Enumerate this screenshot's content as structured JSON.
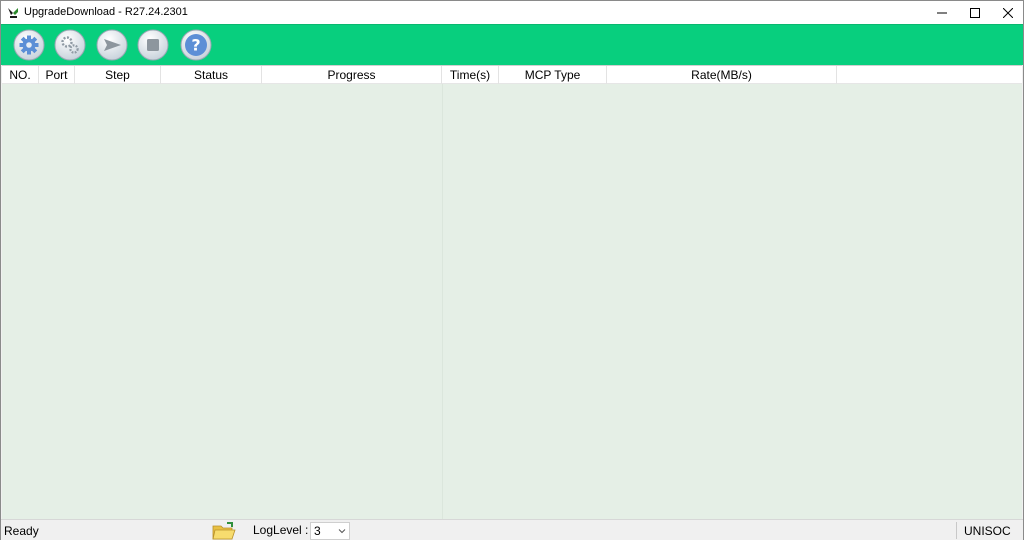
{
  "window": {
    "title": "UpgradeDownload - R27.24.2301",
    "controls": {
      "minimize_icon": "minimize-icon",
      "maximize_icon": "maximize-icon",
      "close_icon": "close-icon"
    }
  },
  "toolbar": {
    "background": "#08cf7e",
    "buttons": [
      {
        "icon": "gear-icon"
      },
      {
        "icon": "gears-icon"
      },
      {
        "icon": "play-arrow-icon"
      },
      {
        "icon": "stop-icon"
      },
      {
        "icon": "help-question-icon"
      }
    ]
  },
  "table": {
    "background": "#e5efe6",
    "columns": [
      "NO.",
      "Port",
      "Step",
      "Status",
      "Progress",
      "Time(s)",
      "MCP Type",
      "Rate(MB/s)"
    ],
    "rows": []
  },
  "statusbar": {
    "status": "Ready",
    "folder_icon": "open-folder-icon",
    "loglevel_label": "LogLevel :",
    "loglevel_value": "3",
    "brand": "UNISOC"
  }
}
